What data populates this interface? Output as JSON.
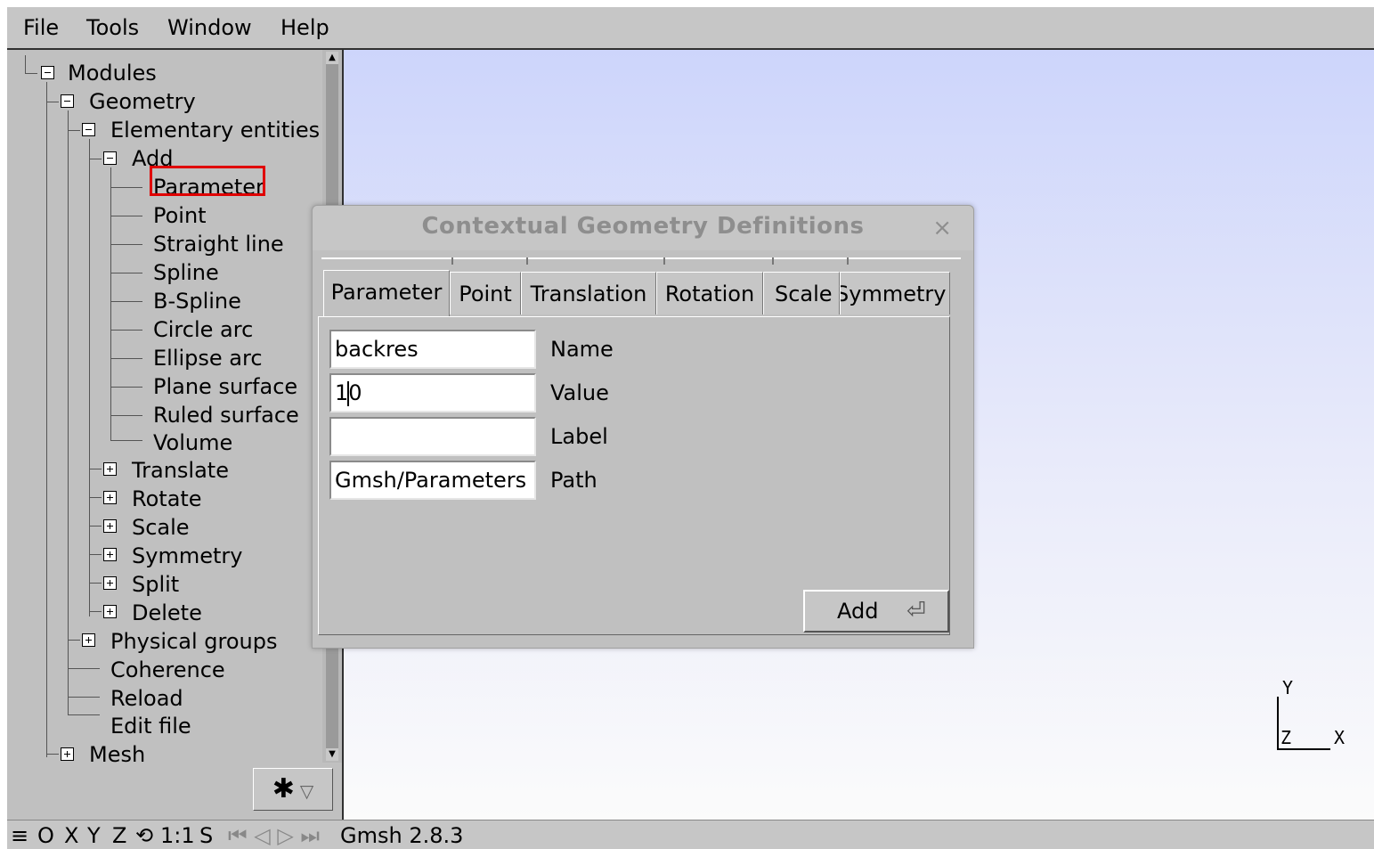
{
  "menubar": {
    "file": "File",
    "tools": "Tools",
    "window": "Window",
    "help": "Help"
  },
  "tree": {
    "modules": "Modules",
    "geometry": "Geometry",
    "elementary_entities": "Elementary entities",
    "add": "Add",
    "add_items": [
      "Parameter",
      "Point",
      "Straight line",
      "Spline",
      "B-Spline",
      "Circle arc",
      "Ellipse arc",
      "Plane surface",
      "Ruled surface",
      "Volume"
    ],
    "ops": [
      "Translate",
      "Rotate",
      "Scale",
      "Symmetry",
      "Split",
      "Delete"
    ],
    "physical_groups": "Physical groups",
    "geometry_leaves": [
      "Coherence",
      "Reload",
      "Edit file"
    ],
    "mesh": "Mesh"
  },
  "gear_button": {
    "icon": "gear-icon",
    "symbol": "✱",
    "dropdown": "▽"
  },
  "dialog": {
    "title": "Contextual Geometry Definitions",
    "close": "×",
    "tabs": [
      "Parameter",
      "Point",
      "Translation",
      "Rotation",
      "Scale",
      "Symmetry"
    ],
    "active_tab": "Parameter",
    "fields": {
      "name": {
        "value": "backres",
        "label": "Name"
      },
      "value": {
        "before_caret": "1",
        "after_caret": "0",
        "label": "Value"
      },
      "label": {
        "value": "",
        "label": "Label"
      },
      "path": {
        "value": "Gmsh/Parameters",
        "label": "Path"
      }
    },
    "add_button": {
      "label": "Add",
      "icon": "enter-key-icon",
      "symbol": "⏎"
    }
  },
  "axes": {
    "y": "Y",
    "z": "Z",
    "x": "X"
  },
  "statusbar": {
    "menu_icon": "≡",
    "o": "O",
    "x": "X",
    "y": "Y",
    "z": "Z",
    "rotate_icon": "⟲",
    "scale": "1:1",
    "s": "S",
    "nav": "⏮ ◁ ▷ ⏭",
    "version": "Gmsh 2.8.3"
  },
  "colors": {
    "highlight": "#e00000",
    "graphics_top": "#cdd5fb",
    "graphics_bottom": "#fbfbfb"
  }
}
